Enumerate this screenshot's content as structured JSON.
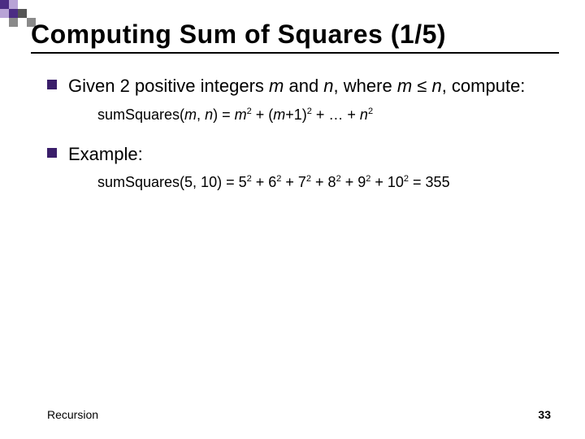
{
  "title": "Computing Sum of Squares (1/5)",
  "bullets": [
    {
      "pre": "Given 2 positive integers ",
      "m": "m",
      "mid1": " and ",
      "n": "n",
      "mid2": ", where ",
      "ineq_l": "m",
      "ineq_op": " ≤ ",
      "ineq_r": "n",
      "post": ", compute:",
      "formula_fn": "sumSquares(",
      "formula_args_m": "m",
      "formula_args_sep": ", ",
      "formula_args_n": "n",
      "formula_eq": ") = ",
      "t1_base": "m",
      "t1_exp": "2",
      "plus1": " + (",
      "t2_base": "m",
      "t2_plus": "+1)",
      "t2_exp": "2",
      "plus2": " + … + ",
      "t3_base": "n",
      "t3_exp": "2"
    },
    {
      "label": "Example:",
      "formula_fn": "sumSquares(5, 10) = 5",
      "e1": "2",
      "p1": " + 6",
      "e2": "2",
      "p2": " + 7",
      "e3": "2",
      "p3": " + 8",
      "e4": "2",
      "p4": " + 9",
      "e5": "2",
      "p5": " + 10",
      "e6": "2",
      "result": " = 355"
    }
  ],
  "footer": {
    "left": "Recursion",
    "right": "33"
  }
}
